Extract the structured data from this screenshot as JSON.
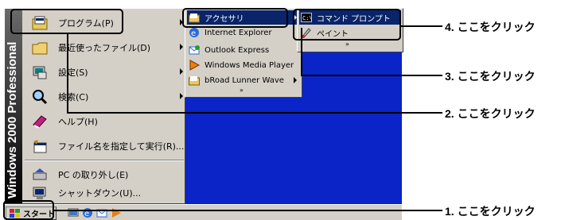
{
  "start_menu": {
    "banner_bold": "Windows",
    "banner_light": "2000",
    "banner_edition": "Professional",
    "items": [
      {
        "label": "プログラム(P)",
        "icon": "programs-folder-icon"
      },
      {
        "label": "最近使ったファイル(D)",
        "icon": "documents-folder-icon"
      },
      {
        "label": "設定(S)",
        "icon": "settings-icon"
      },
      {
        "label": "検索(C)",
        "icon": "search-magnifier-icon"
      },
      {
        "label": "ヘルプ(H)",
        "icon": "help-book-icon"
      },
      {
        "label": "ファイル名を指定して実行(R)...",
        "icon": "run-icon"
      },
      {
        "label": "PC の取り外し(E)",
        "icon": "eject-pc-icon"
      },
      {
        "label": "シャットダウン(U)...",
        "icon": "shutdown-icon"
      }
    ]
  },
  "programs_menu": {
    "items": [
      {
        "label": "アクセサリ",
        "icon": "accessories-folder-icon"
      },
      {
        "label": "Internet Explorer",
        "icon": "internet-explorer-icon"
      },
      {
        "label": "Outlook Express",
        "icon": "outlook-express-icon"
      },
      {
        "label": "Windows Media Player",
        "icon": "media-player-icon"
      },
      {
        "label": "bRoad Lunner Wave",
        "icon": "program-folder-icon"
      }
    ],
    "more": "»"
  },
  "accessories_menu": {
    "items": [
      {
        "label": "コマンド プロンプト",
        "icon": "command-prompt-icon"
      },
      {
        "label": "ペイント",
        "icon": "paint-icon"
      }
    ],
    "more": "»"
  },
  "taskbar": {
    "start_label": "スタート"
  },
  "callouts": [
    "1. ここをクリック",
    "2. ここをクリック",
    "3. ここをクリック",
    "4. ここをクリック"
  ],
  "colors": {
    "desktop": "#0a24c8",
    "menu_bg": "#d4d0c8",
    "highlight": "#0a246a"
  }
}
